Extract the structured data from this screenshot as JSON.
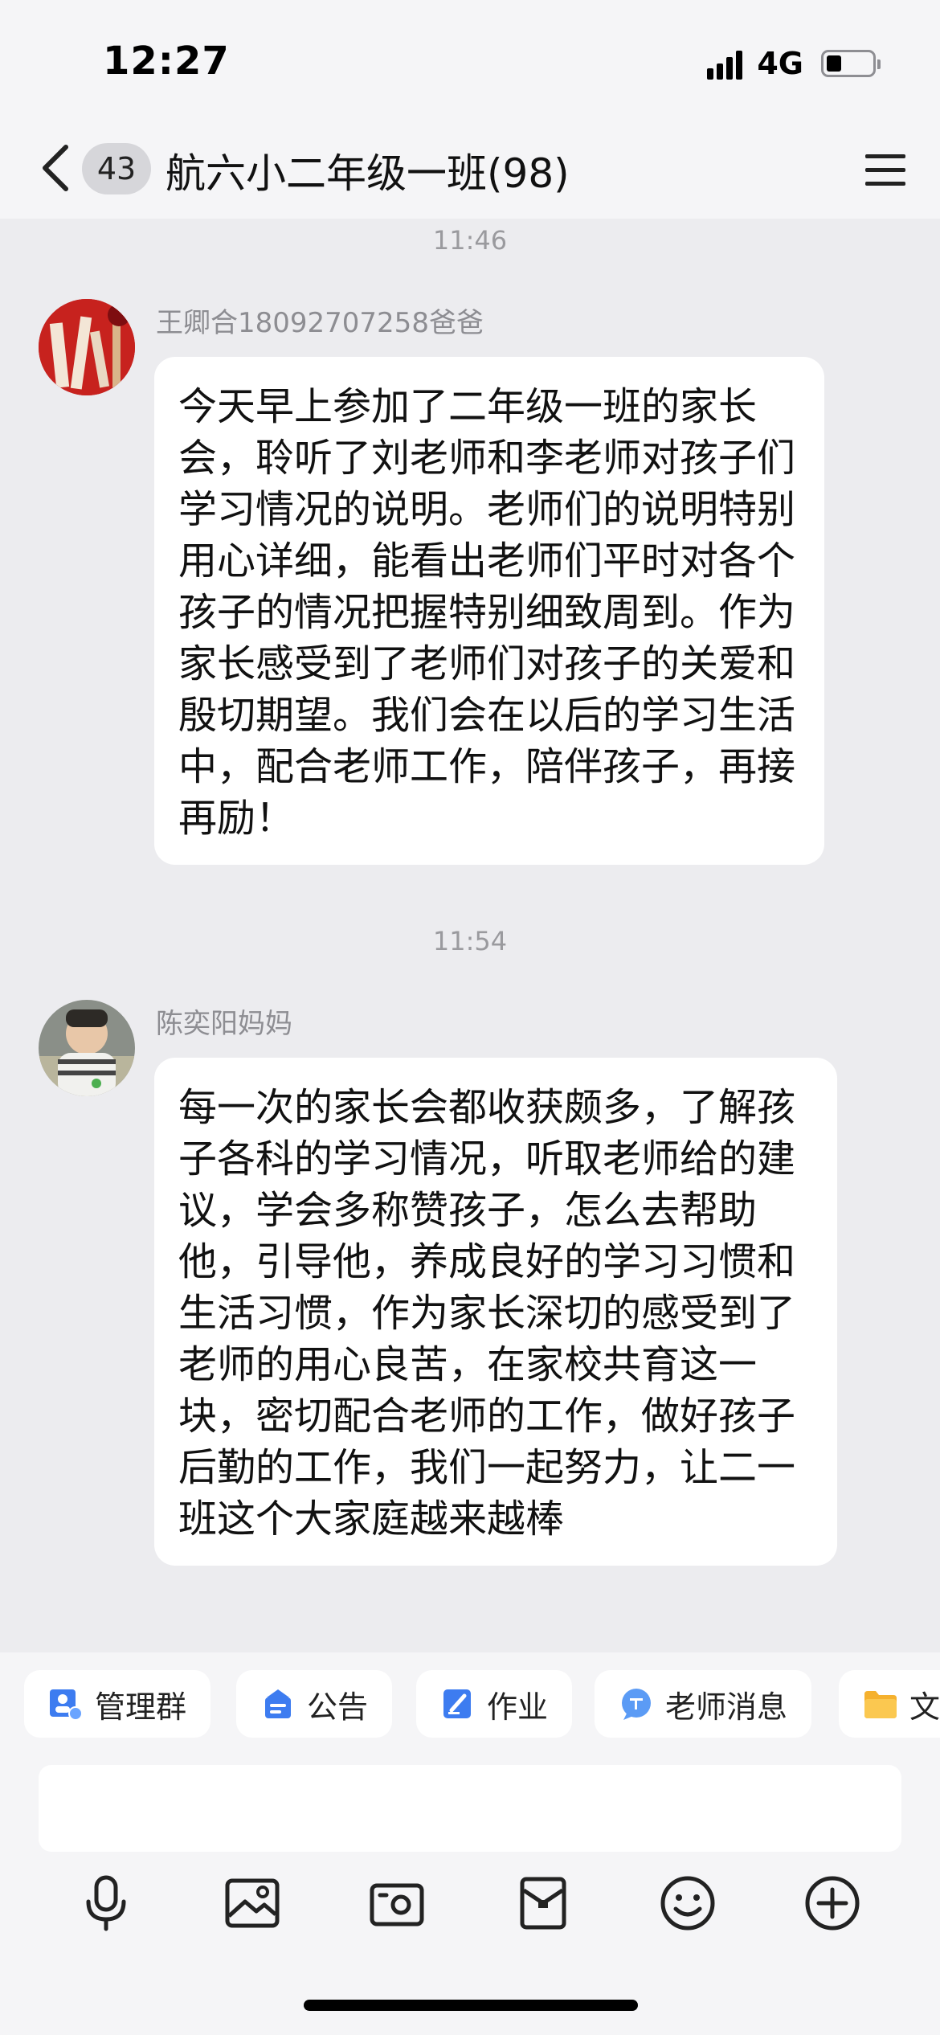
{
  "status_bar": {
    "time": "12:27",
    "network": "4G",
    "battery_level": 0.35
  },
  "header": {
    "unread_count": "43",
    "title": "航六小二年级一班(98)",
    "back_icon": "chevron-left-icon",
    "menu_icon": "hamburger-menu-icon"
  },
  "messages": [
    {
      "time_divider": "11:46",
      "sender": "王卿合18092707258爸爸",
      "text": "今天早上参加了二年级一班的家长会，聆听了刘老师和李老师对孩子们学习情况的说明。老师们的说明特别用心详细，能看出老师们平时对各个孩子的情况把握特别细致周到。作为家长感受到了老师们对孩子的关爱和殷切期望。我们会在以后的学习生活中，配合老师工作，陪伴孩子，再接再励！"
    },
    {
      "time_divider": "11:54",
      "sender": "陈奕阳妈妈",
      "text": "每一次的家长会都收获颇多，了解孩子各科的学习情况，听取老师给的建议，学会多称赞孩子，怎么去帮助他，引导他，养成良好的学习习惯和生活习惯，作为家长深切的感受到了老师的用心良苦，在家校共育这一块，密切配合老师的工作，做好孩子后勤的工作，我们一起努力，让二一班这个大家庭越来越棒"
    }
  ],
  "shortcuts": [
    {
      "label": "管理群",
      "icon": "manage-group-icon",
      "color": "#3d7cf0"
    },
    {
      "label": "公告",
      "icon": "announcement-icon",
      "color": "#3d7cf0"
    },
    {
      "label": "作业",
      "icon": "homework-icon",
      "color": "#3d7cf0"
    },
    {
      "label": "老师消息",
      "icon": "teacher-message-icon",
      "color": "#5b9bf5"
    },
    {
      "label": "文",
      "icon": "folder-icon",
      "color": "#f5b12e"
    }
  ],
  "input": {
    "placeholder": ""
  },
  "toolbar": {
    "icons": [
      "microphone-icon",
      "image-icon",
      "camera-icon",
      "red-packet-icon",
      "emoji-icon",
      "plus-icon"
    ]
  },
  "colors": {
    "background": "#ececef",
    "bar_background": "#f5f5f7",
    "bubble": "#ffffff",
    "accent": "#3d7cf0"
  }
}
